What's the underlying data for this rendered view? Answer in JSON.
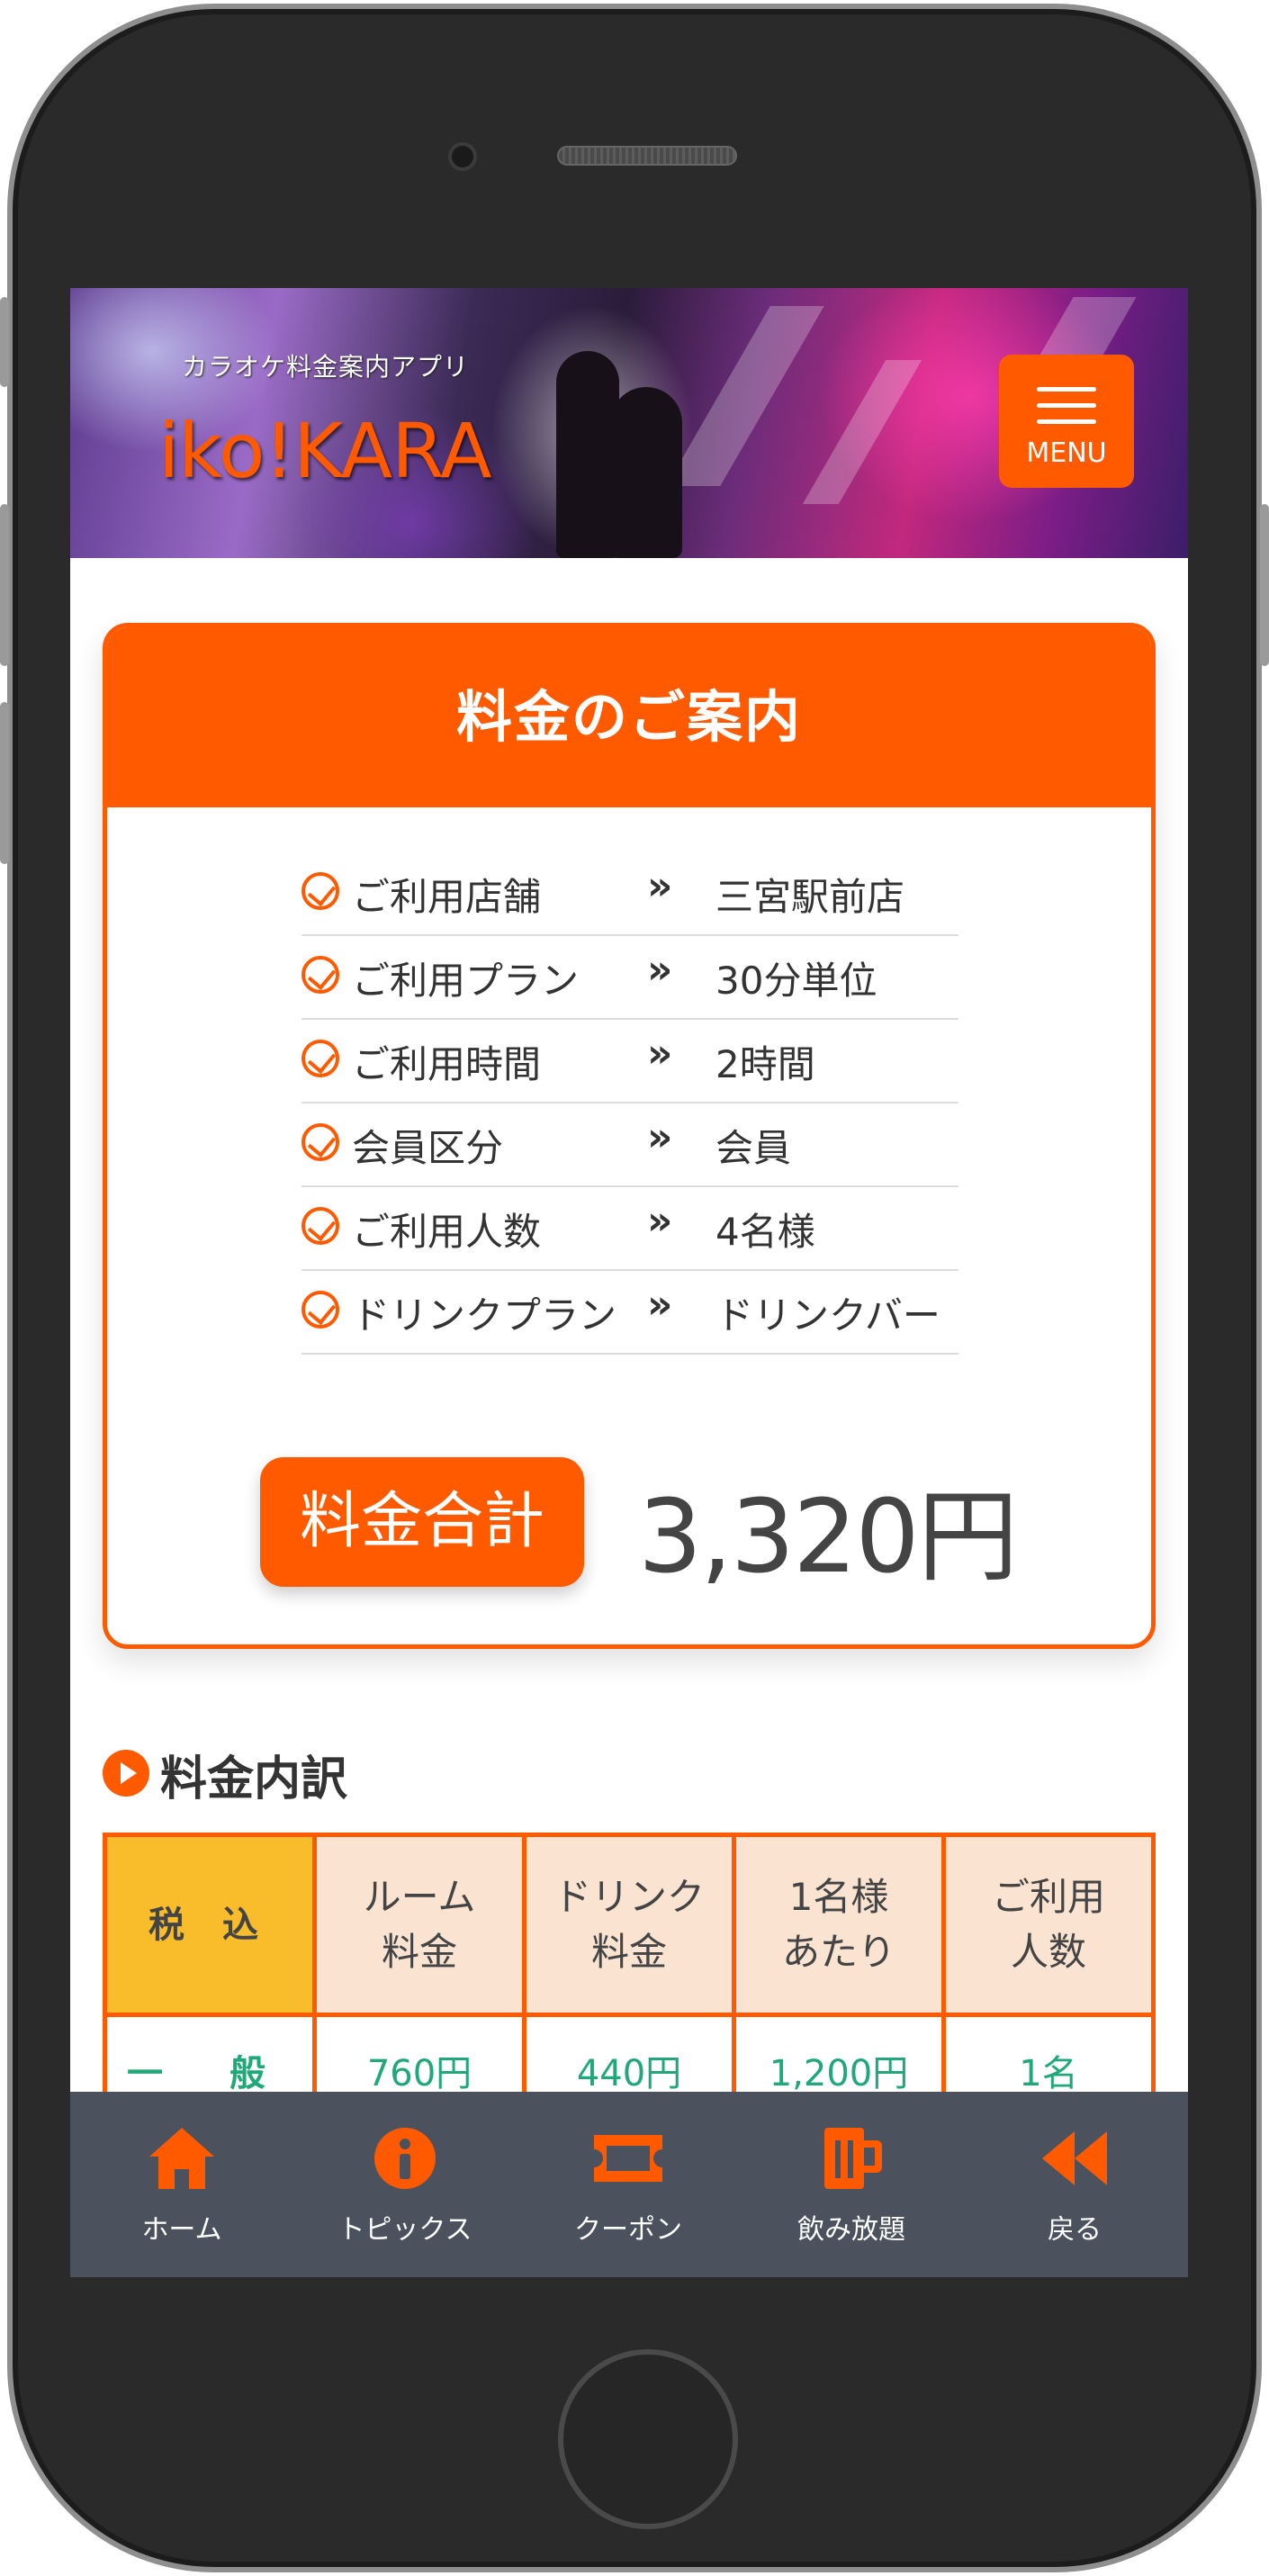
{
  "header": {
    "subtitle": "カラオケ料金案内アプリ",
    "title": "iko!KARA",
    "menu_label": "MENU"
  },
  "card": {
    "heading": "料金のご案内",
    "details": [
      {
        "label": "ご利用店舗",
        "arrow": "»",
        "value": "三宮駅前店"
      },
      {
        "label": "ご利用プラン",
        "arrow": "»",
        "value": "30分単位"
      },
      {
        "label": "ご利用時間",
        "arrow": "»",
        "value": "2時間"
      },
      {
        "label": "会員区分",
        "arrow": "»",
        "value": "会員"
      },
      {
        "label": "ご利用人数",
        "arrow": "»",
        "value": "4名様"
      },
      {
        "label": "ドリンクプラン",
        "arrow": "»",
        "value": "ドリンクバー"
      }
    ],
    "total_label": "料金合計",
    "total_value": "3,320円"
  },
  "breakdown": {
    "title": "料金内訳",
    "headers": [
      "税 込",
      "ルーム\n料金",
      "ドリンク\n料金",
      "1名様\nあたり",
      "ご利用\n人数"
    ],
    "rows": [
      [
        "一 般",
        "760円",
        "440円",
        "1,200円",
        "1名"
      ]
    ]
  },
  "nav": {
    "items": [
      {
        "label": "ホーム",
        "icon": "home-icon"
      },
      {
        "label": "トピックス",
        "icon": "info-icon"
      },
      {
        "label": "クーポン",
        "icon": "ticket-icon"
      },
      {
        "label": "飲み放題",
        "icon": "beer-mug-icon"
      },
      {
        "label": "戻る",
        "icon": "rewind-icon"
      }
    ]
  },
  "colors": {
    "accent": "#ff5a00",
    "nav_bg": "#4b525e",
    "table_header": "#fae3d1",
    "tax_header": "#f9bc2b",
    "table_value": "#20a878"
  }
}
